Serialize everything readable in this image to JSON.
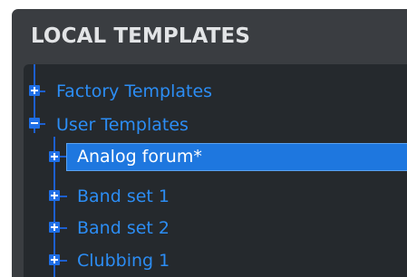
{
  "panel": {
    "title": "LOCAL TEMPLATES"
  },
  "tree": {
    "groups": [
      {
        "label": "Factory Templates",
        "expanded": false
      },
      {
        "label": "User Templates",
        "expanded": true
      }
    ],
    "user_templates": [
      {
        "label": "Analog forum*",
        "selected": true
      },
      {
        "label": "Band set 1",
        "selected": false
      },
      {
        "label": "Band set 2",
        "selected": false
      },
      {
        "label": "Clubbing 1",
        "selected": false
      }
    ]
  },
  "colors": {
    "panel_bg": "#3a3d41",
    "tree_bg": "#25292d",
    "accent": "#2c8df4",
    "selection": "#1e77df",
    "title_text": "#e2e4e6"
  },
  "icons": {
    "expand": "plus-square-icon",
    "collapse": "minus-square-icon"
  }
}
